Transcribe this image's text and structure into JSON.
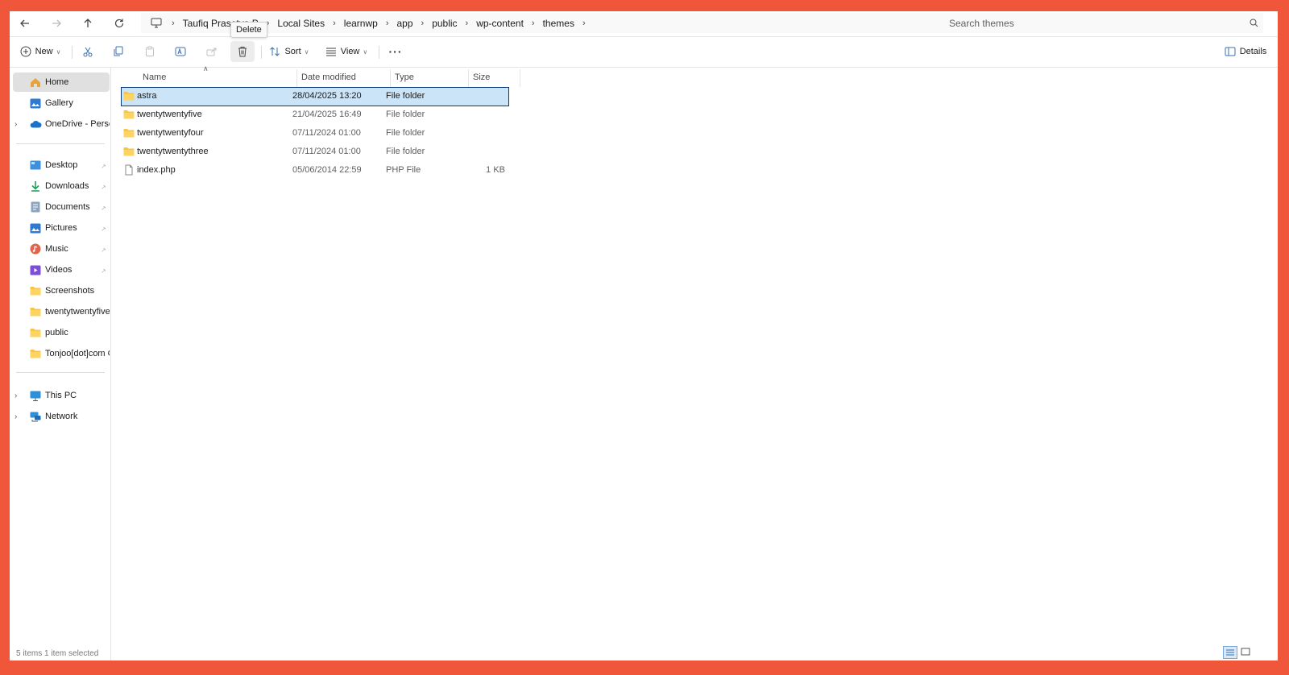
{
  "nav": {
    "back": "back",
    "forward": "forward",
    "up": "up",
    "refresh": "refresh"
  },
  "breadcrumb": [
    "Taufiq Prasetya P",
    "Local Sites",
    "learnwp",
    "app",
    "public",
    "wp-content",
    "themes"
  ],
  "search": {
    "placeholder": "Search themes"
  },
  "toolbar": {
    "new_label": "New",
    "sort_label": "Sort",
    "view_label": "View",
    "details_label": "Details",
    "tooltip": "Delete"
  },
  "sidebar": {
    "top": [
      {
        "label": "Home",
        "icon": "home-icon"
      },
      {
        "label": "Gallery",
        "icon": "gallery-icon"
      },
      {
        "label": "OneDrive - Persona",
        "icon": "cloud-icon"
      }
    ],
    "quick": [
      {
        "label": "Desktop",
        "icon": "desktop-icon"
      },
      {
        "label": "Downloads",
        "icon": "download-icon"
      },
      {
        "label": "Documents",
        "icon": "documents-icon"
      },
      {
        "label": "Pictures",
        "icon": "pictures-icon"
      },
      {
        "label": "Music",
        "icon": "music-icon"
      },
      {
        "label": "Videos",
        "icon": "videos-icon"
      },
      {
        "label": "Screenshots",
        "icon": "folder-icon"
      },
      {
        "label": "twentytwentyfive",
        "icon": "folder-icon"
      },
      {
        "label": "public",
        "icon": "folder-icon"
      },
      {
        "label": "Tonjoo[dot]com Ca",
        "icon": "folder-icon"
      }
    ],
    "bottom": [
      {
        "label": "This PC",
        "icon": "pc-icon"
      },
      {
        "label": "Network",
        "icon": "network-icon"
      }
    ]
  },
  "columns": {
    "name": "Name",
    "date": "Date modified",
    "type": "Type",
    "size": "Size"
  },
  "files": [
    {
      "name": "astra",
      "date": "28/04/2025 13:20",
      "type": "File folder",
      "size": "",
      "kind": "folder"
    },
    {
      "name": "twentytwentyfive",
      "date": "21/04/2025 16:49",
      "type": "File folder",
      "size": "",
      "kind": "folder"
    },
    {
      "name": "twentytwentyfour",
      "date": "07/11/2024 01:00",
      "type": "File folder",
      "size": "",
      "kind": "folder"
    },
    {
      "name": "twentytwentythree",
      "date": "07/11/2024 01:00",
      "type": "File folder",
      "size": "",
      "kind": "folder"
    },
    {
      "name": "index.php",
      "date": "05/06/2014 22:59",
      "type": "PHP File",
      "size": "1 KB",
      "kind": "file"
    }
  ],
  "status": {
    "text": "5 items   1 item selected"
  },
  "colors": {
    "frame": "#F0573A",
    "selection": "#cce4f7",
    "folder": "#F8C445"
  }
}
